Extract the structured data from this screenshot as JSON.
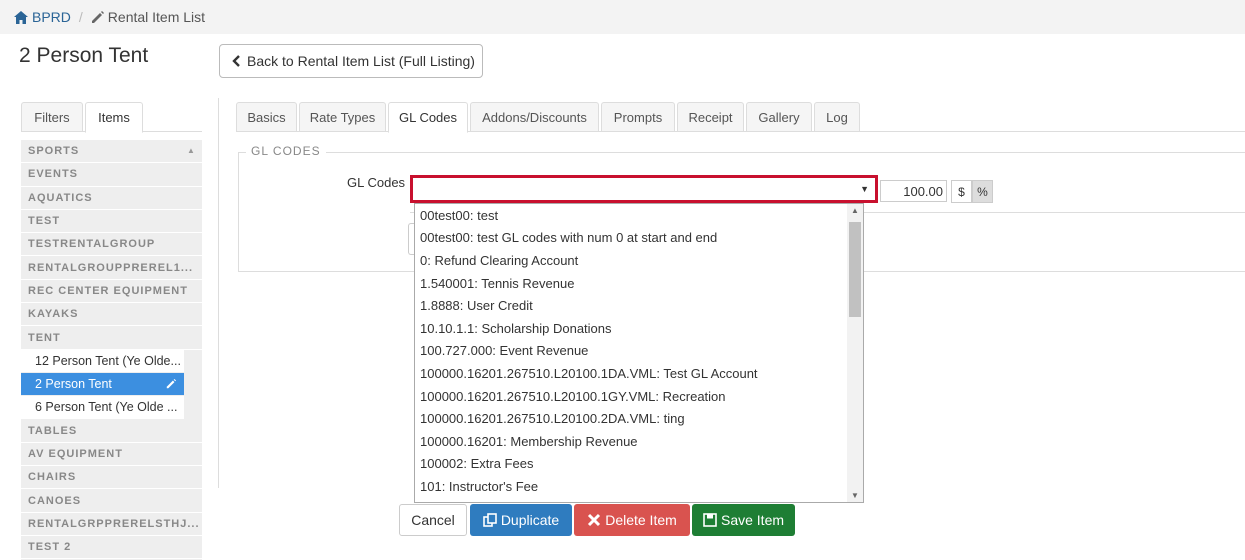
{
  "breadcrumb": {
    "home": "BPRD",
    "separator": "/",
    "current": "Rental Item List"
  },
  "page_title": "2 Person Tent",
  "back_button": "Back to Rental Item List (Full Listing)",
  "left_tabs": [
    "Filters",
    "Items"
  ],
  "item_list": [
    {
      "label": "SPORTS",
      "kind": "group"
    },
    {
      "label": "EVENTS",
      "kind": "group"
    },
    {
      "label": "AQUATICS",
      "kind": "group"
    },
    {
      "label": "TEST",
      "kind": "group"
    },
    {
      "label": "TESTRENTALGROUP",
      "kind": "group"
    },
    {
      "label": "RENTALGROUPPREREL1...",
      "kind": "group"
    },
    {
      "label": "REC CENTER EQUIPMENT",
      "kind": "group"
    },
    {
      "label": "KAYAKS",
      "kind": "group"
    },
    {
      "label": "TENT",
      "kind": "group"
    },
    {
      "label": "12 Person Tent (Ye Olde...",
      "kind": "child"
    },
    {
      "label": "2 Person Tent",
      "kind": "selected"
    },
    {
      "label": "6 Person Tent (Ye Olde ...",
      "kind": "child"
    },
    {
      "label": "TABLES",
      "kind": "group"
    },
    {
      "label": "AV EQUIPMENT",
      "kind": "group"
    },
    {
      "label": "CHAIRS",
      "kind": "group"
    },
    {
      "label": "CANOES",
      "kind": "group"
    },
    {
      "label": "RENTALGRPPRERELSTHJ...",
      "kind": "group"
    },
    {
      "label": "TEST 2",
      "kind": "group"
    }
  ],
  "tabs": [
    "Basics",
    "Rate Types",
    "GL Codes",
    "Addons/Discounts",
    "Prompts",
    "Receipt",
    "Gallery",
    "Log"
  ],
  "active_tab": "GL Codes",
  "section_legend": "GL CODES",
  "gl_codes_label": "GL Codes",
  "amount_value": "100.00",
  "unit_dollar": "$",
  "unit_percent": "%",
  "dropdown_options": [
    "00test00: test",
    "00test00: test GL codes with num 0 at start and end",
    "0: Refund Clearing Account",
    "1.540001: Tennis Revenue",
    "1.8888: User Credit",
    "10.10.1.1: Scholarship Donations",
    "100.727.000: Event Revenue",
    "100000.16201.267510.L20100.1DA.VML: Test GL Account",
    "100000.16201.267510.L20100.1GY.VML: Recreation",
    "100000.16201.267510.L20100.2DA.VML: ting",
    "100000.16201: Membership Revenue",
    "100002: Extra Fees",
    "101: Instructor's Fee"
  ],
  "buttons": {
    "cancel": "Cancel",
    "duplicate": "Duplicate",
    "delete": "Delete Item",
    "save": "Save Item"
  },
  "colors": {
    "selected_item": "#3c8fe0",
    "highlight_border": "#c8102e",
    "duplicate": "#2f7cbf",
    "delete": "#d9534f",
    "save": "#1e7e34"
  }
}
